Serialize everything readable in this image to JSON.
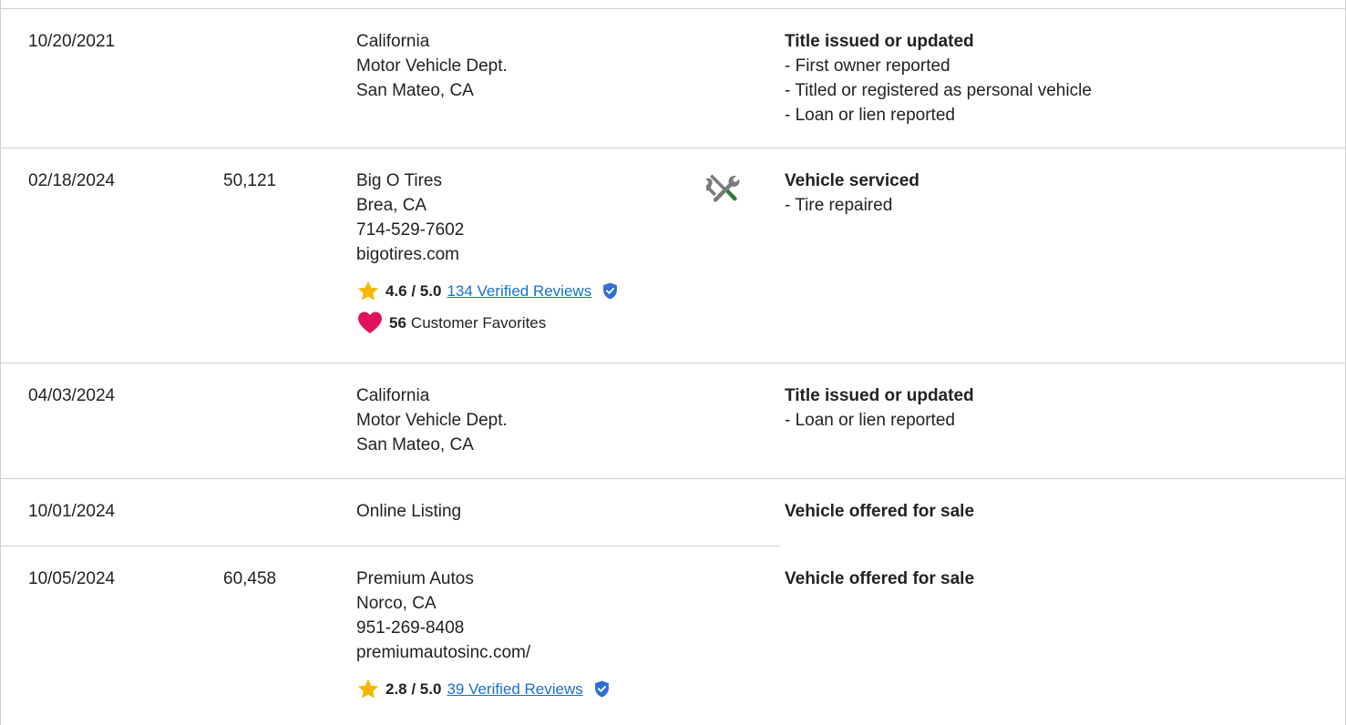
{
  "records": [
    {
      "date": "10/20/2021",
      "mileage": "",
      "source": [
        "California",
        "Motor Vehicle Dept.",
        "San Mateo, CA"
      ],
      "event_title": "Title issued or updated",
      "details": [
        "- First owner reported",
        "- Titled or registered as personal vehicle",
        "- Loan or lien reported"
      ]
    },
    {
      "date": "02/18/2024",
      "mileage": "50,121",
      "source": [
        "Big O Tires",
        "Brea, CA",
        "714-529-7602",
        "bigotires.com"
      ],
      "icon": "service-tools-icon",
      "rating": "4.6 / 5.0",
      "reviews_link": "134 Verified Reviews",
      "favorites_count": "56",
      "favorites_label": "Customer Favorites",
      "event_title": "Vehicle serviced",
      "details": [
        "- Tire repaired"
      ]
    },
    {
      "date": "04/03/2024",
      "mileage": "",
      "source": [
        "California",
        "Motor Vehicle Dept.",
        "San Mateo, CA"
      ],
      "event_title": "Title issued or updated",
      "details": [
        "- Loan or lien reported"
      ]
    },
    {
      "date": "10/01/2024",
      "mileage": "",
      "source": [
        "Online Listing"
      ],
      "event_title": "Vehicle offered for sale",
      "details": []
    },
    {
      "date": "10/05/2024",
      "mileage": "60,458",
      "source": [
        "Premium Autos",
        "Norco, CA",
        "951-269-8408",
        "premiumautosinc.com/"
      ],
      "rating": "2.8 / 5.0",
      "reviews_link": "39 Verified Reviews",
      "event_title": "Vehicle offered for sale",
      "details": []
    }
  ],
  "colors": {
    "star": "#f5b800",
    "heart": "#e0125e",
    "link": "#1a6fd1",
    "verified": "#2f6fd6",
    "divider": "#cfcfcf",
    "wrench": "#7a7a7a",
    "screwdriver_handle": "#2e7d32"
  }
}
